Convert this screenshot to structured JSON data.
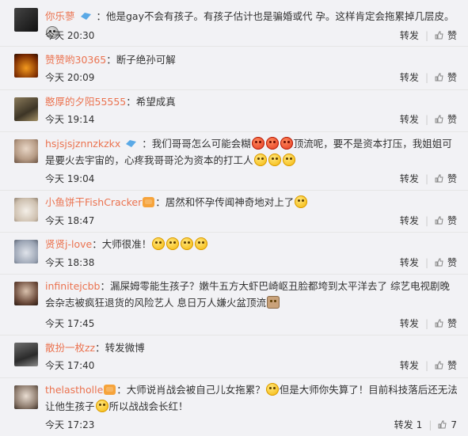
{
  "actions": {
    "repost": "转发",
    "like": "赞"
  },
  "comments": [
    {
      "user": "你乐蓼",
      "text_pre": "：他是gay不会有孩子。有孩子估计也是骗婚或代 孕。这样肯定会拖累掉几层皮。",
      "text_post": "",
      "time": "今天 20:30",
      "like_count": "",
      "has_vip": true,
      "badge": false
    },
    {
      "user": "赞赞哟30365",
      "text_pre": "：断子绝孙可解",
      "text_post": "",
      "time": "今天 20:09",
      "like_count": "",
      "has_vip": false,
      "badge": false
    },
    {
      "user": "憨厚的夕阳55555",
      "text_pre": "：希望成真",
      "text_post": "",
      "time": "今天 19:14",
      "like_count": "",
      "has_vip": false,
      "badge": false
    },
    {
      "user": "hsjsjsjznnzkzkx",
      "text_pre": "：我们哥哥怎么可能会糊",
      "text_mid": "顶流呢，要不是资本打压，我姐姐可是要火去宇宙的，心疼我哥哥沦为资本的打工人",
      "text_post": "",
      "time": "今天 19:04",
      "like_count": "",
      "has_vip": true,
      "badge": false
    },
    {
      "user": "小鱼饼干FishCracker",
      "text_pre": "：居然和怀孕传闻神奇地对上了",
      "text_post": "",
      "time": "今天 18:47",
      "like_count": "",
      "has_vip": false,
      "badge": true
    },
    {
      "user": "贤贤j-love",
      "text_pre": "：大师很准！",
      "text_post": "",
      "time": "今天 18:38",
      "like_count": "",
      "has_vip": false,
      "badge": false
    },
    {
      "user": "infinitejcbb",
      "text_pre": "：漏屎姆零能生孩子？嫩牛五方大虾巴崎岖丑脸都垮到太平洋去了 综艺电视剧晚会杂志被疯狂退货的风险艺人 息日万人嫌火盆顶流",
      "text_post": "",
      "time": "今天 17:45",
      "like_count": "",
      "has_vip": false,
      "badge": false
    },
    {
      "user": "散扮一枚zz",
      "text_pre": "：转发微博",
      "text_post": "",
      "time": "今天 17:40",
      "like_count": "",
      "has_vip": false,
      "badge": false
    },
    {
      "user": "thelastholle",
      "text_pre": "：大师说肖战会被自己儿女拖累？",
      "text_mid": "但是大师你失算了！目前科技落后还无法让他生孩子",
      "text_post": "所以战战会长红！",
      "time": "今天 17:23",
      "repost_count": "1",
      "like_count": "7",
      "has_vip": false,
      "badge": true
    }
  ]
}
